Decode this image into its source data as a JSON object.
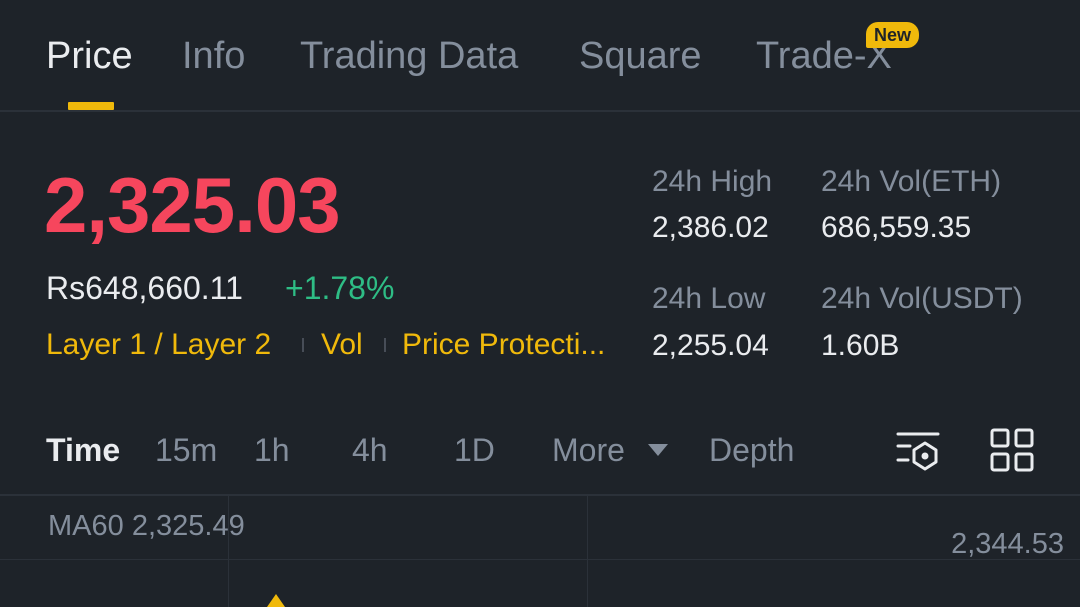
{
  "tabs": [
    {
      "label": "Price"
    },
    {
      "label": "Info"
    },
    {
      "label": "Trading Data"
    },
    {
      "label": "Square"
    },
    {
      "label": "Trade-X",
      "badge": "New"
    }
  ],
  "price": {
    "last": "2,325.03",
    "fiat": "Rs648,660.11",
    "change": "+1.78%"
  },
  "tags": [
    "Layer 1 / Layer 2",
    "Vol",
    "Price Protecti..."
  ],
  "stats": {
    "high_label": "24h High",
    "high_value": "2,386.02",
    "vol_base_label": "24h Vol(ETH)",
    "vol_base_value": "686,559.35",
    "low_label": "24h Low",
    "low_value": "2,255.04",
    "vol_quote_label": "24h Vol(USDT)",
    "vol_quote_value": "1.60B"
  },
  "intervals": [
    "Time",
    "15m",
    "1h",
    "4h",
    "1D",
    "More",
    "Depth"
  ],
  "icons": [
    "chart-settings-icon",
    "grid-layout-icon"
  ],
  "chart": {
    "ma_label": "MA60 2,325.49",
    "axis_price": "2,344.53"
  },
  "colors": {
    "background": "#1e2329",
    "accent": "#f0b90b",
    "down": "#f6465d",
    "up": "#2ebd85",
    "muted": "#848e9c"
  }
}
